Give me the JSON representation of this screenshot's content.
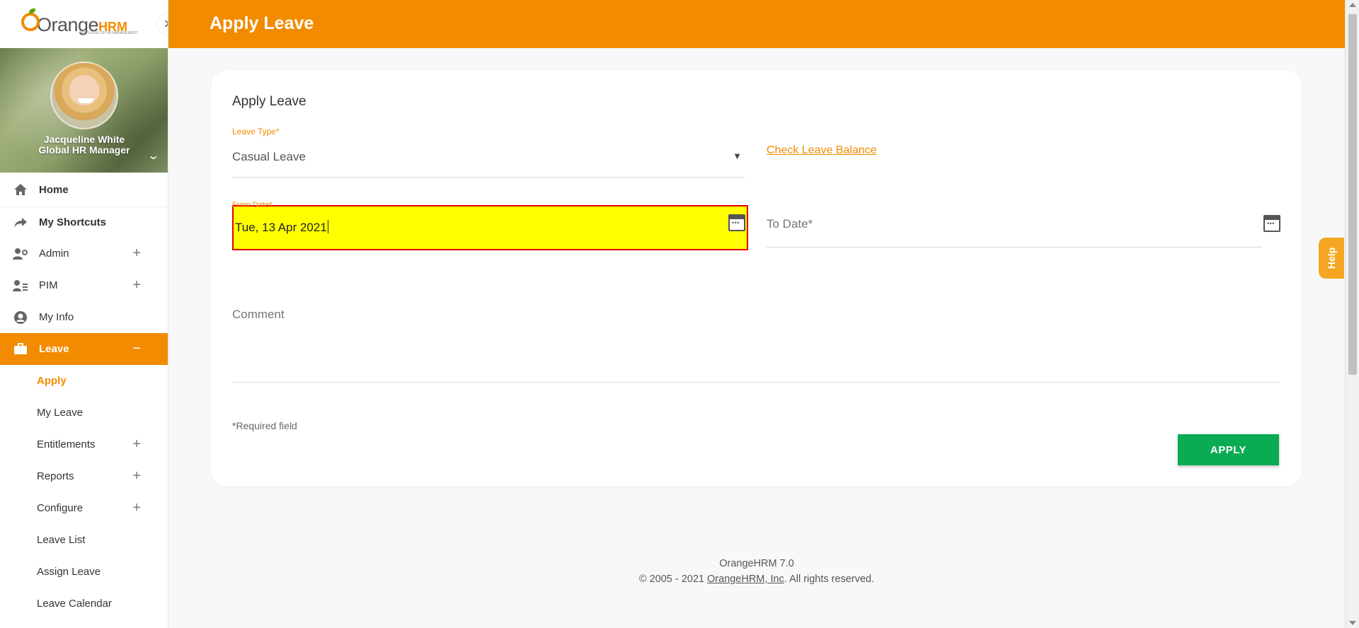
{
  "app": {
    "logo_text": "Orange",
    "logo_hrm": "HRM",
    "logo_tagline": "NEW LEVEL OF HR MANAGEMENT",
    "collapse_icon": "×"
  },
  "profile": {
    "name": "Jacqueline White",
    "role": "Global HR Manager"
  },
  "sidebar": {
    "items": [
      {
        "label": "Home"
      },
      {
        "label": "My Shortcuts"
      },
      {
        "label": "Admin"
      },
      {
        "label": "PIM"
      },
      {
        "label": "My Info"
      },
      {
        "label": "Leave"
      }
    ],
    "leave_sub": [
      {
        "label": "Apply"
      },
      {
        "label": "My Leave"
      },
      {
        "label": "Entitlements"
      },
      {
        "label": "Reports"
      },
      {
        "label": "Configure"
      },
      {
        "label": "Leave List"
      },
      {
        "label": "Assign Leave"
      },
      {
        "label": "Leave Calendar"
      }
    ]
  },
  "header": {
    "title": "Apply Leave"
  },
  "form": {
    "title": "Apply Leave",
    "leave_type_label": "Leave Type*",
    "leave_type_value": "Casual Leave",
    "check_balance": "Check Leave Balance",
    "from_date_label": "From Date*",
    "from_date_value": "Tue, 13 Apr 2021",
    "to_date_label": "To Date*",
    "comment_label": "Comment",
    "required_note": "*Required field",
    "apply_button": "APPLY"
  },
  "help": {
    "label": "Help"
  },
  "footer": {
    "version": "OrangeHRM 7.0",
    "copyright_prefix": "© 2005 - 2021 ",
    "company_link": "OrangeHRM, Inc",
    "copyright_suffix": ". All rights reserved."
  },
  "colors": {
    "brand": "#f28b00",
    "apply_button": "#0bab53",
    "highlight": "#ffff00"
  }
}
